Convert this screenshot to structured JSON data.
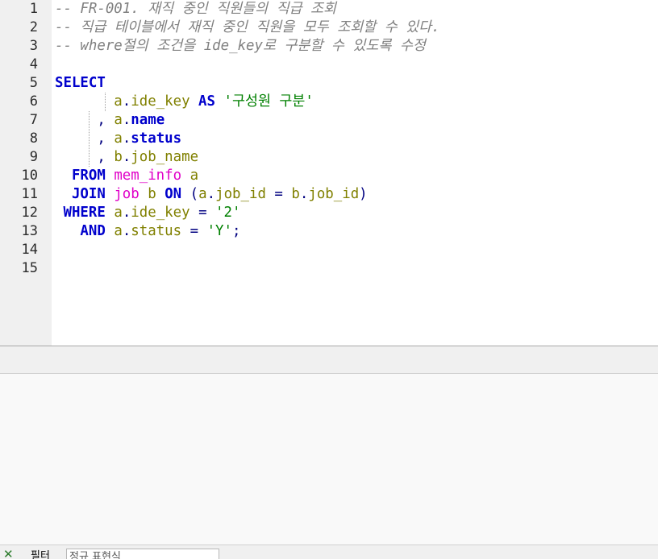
{
  "editor": {
    "line_numbers": [
      "1",
      "2",
      "3",
      "4",
      "5",
      "6",
      "7",
      "8",
      "9",
      "10",
      "11",
      "12",
      "13",
      "14",
      "15"
    ],
    "lines": [
      [
        {
          "t": "-- FR-001. 재직 중인 직원들의 직급 조회",
          "c": "cmt"
        }
      ],
      [
        {
          "t": "-- 직급 테이블에서 재직 중인 직원을 모두 조회할 수 있다.",
          "c": "cmt"
        }
      ],
      [
        {
          "t": "-- where절의 조건을 ide_key로 구분할 수 있도록 수정",
          "c": "cmt"
        }
      ],
      [],
      [
        {
          "t": "SELECT",
          "c": "kw"
        }
      ],
      [
        {
          "t": "       ",
          "c": ""
        },
        {
          "t": "a",
          "c": "id"
        },
        {
          "t": ".",
          "c": "op"
        },
        {
          "t": "ide_key",
          "c": "id"
        },
        {
          "t": " ",
          "c": ""
        },
        {
          "t": "AS",
          "c": "kw"
        },
        {
          "t": " ",
          "c": ""
        },
        {
          "t": "'구성원 구분'",
          "c": "str"
        }
      ],
      [
        {
          "t": "     ",
          "c": ""
        },
        {
          "t": ",",
          "c": "op"
        },
        {
          "t": " ",
          "c": ""
        },
        {
          "t": "a",
          "c": "id"
        },
        {
          "t": ".",
          "c": "op"
        },
        {
          "t": "name",
          "c": "kw"
        }
      ],
      [
        {
          "t": "     ",
          "c": ""
        },
        {
          "t": ",",
          "c": "op"
        },
        {
          "t": " ",
          "c": ""
        },
        {
          "t": "a",
          "c": "id"
        },
        {
          "t": ".",
          "c": "op"
        },
        {
          "t": "status",
          "c": "kw"
        }
      ],
      [
        {
          "t": "     ",
          "c": ""
        },
        {
          "t": ",",
          "c": "op"
        },
        {
          "t": " ",
          "c": ""
        },
        {
          "t": "b",
          "c": "id"
        },
        {
          "t": ".",
          "c": "op"
        },
        {
          "t": "job_name",
          "c": "id"
        }
      ],
      [
        {
          "t": "  ",
          "c": ""
        },
        {
          "t": "FROM",
          "c": "kw"
        },
        {
          "t": " ",
          "c": ""
        },
        {
          "t": "mem_info",
          "c": "tbl"
        },
        {
          "t": " ",
          "c": ""
        },
        {
          "t": "a",
          "c": "id"
        }
      ],
      [
        {
          "t": "  ",
          "c": ""
        },
        {
          "t": "JOIN",
          "c": "kw"
        },
        {
          "t": " ",
          "c": ""
        },
        {
          "t": "job",
          "c": "tbl"
        },
        {
          "t": " ",
          "c": ""
        },
        {
          "t": "b",
          "c": "id"
        },
        {
          "t": " ",
          "c": ""
        },
        {
          "t": "ON",
          "c": "kw"
        },
        {
          "t": " ",
          "c": ""
        },
        {
          "t": "(",
          "c": "op"
        },
        {
          "t": "a",
          "c": "id"
        },
        {
          "t": ".",
          "c": "op"
        },
        {
          "t": "job_id",
          "c": "id"
        },
        {
          "t": " ",
          "c": ""
        },
        {
          "t": "=",
          "c": "op"
        },
        {
          "t": " ",
          "c": ""
        },
        {
          "t": "b",
          "c": "id"
        },
        {
          "t": ".",
          "c": "op"
        },
        {
          "t": "job_id",
          "c": "id"
        },
        {
          "t": ")",
          "c": "op"
        }
      ],
      [
        {
          "t": " ",
          "c": ""
        },
        {
          "t": "WHERE",
          "c": "kw"
        },
        {
          "t": " ",
          "c": ""
        },
        {
          "t": "a",
          "c": "id"
        },
        {
          "t": ".",
          "c": "op"
        },
        {
          "t": "ide_key",
          "c": "id"
        },
        {
          "t": " ",
          "c": ""
        },
        {
          "t": "=",
          "c": "op"
        },
        {
          "t": " ",
          "c": ""
        },
        {
          "t": "'2'",
          "c": "str"
        }
      ],
      [
        {
          "t": "   ",
          "c": ""
        },
        {
          "t": "AND",
          "c": "kw"
        },
        {
          "t": " ",
          "c": ""
        },
        {
          "t": "a",
          "c": "id"
        },
        {
          "t": ".",
          "c": "op"
        },
        {
          "t": "status",
          "c": "id"
        },
        {
          "t": " ",
          "c": ""
        },
        {
          "t": "=",
          "c": "op"
        },
        {
          "t": " ",
          "c": ""
        },
        {
          "t": "'Y'",
          "c": "str"
        },
        {
          "t": ";",
          "c": "op"
        }
      ],
      [],
      []
    ]
  },
  "filter": {
    "label": "필터",
    "placeholder": "정규 표현식",
    "close_icon": "close-icon"
  },
  "colors": {
    "keyword": "#0000cc",
    "identifier": "#808000",
    "string": "#008000",
    "table": "#e000c8",
    "comment": "#808080"
  }
}
